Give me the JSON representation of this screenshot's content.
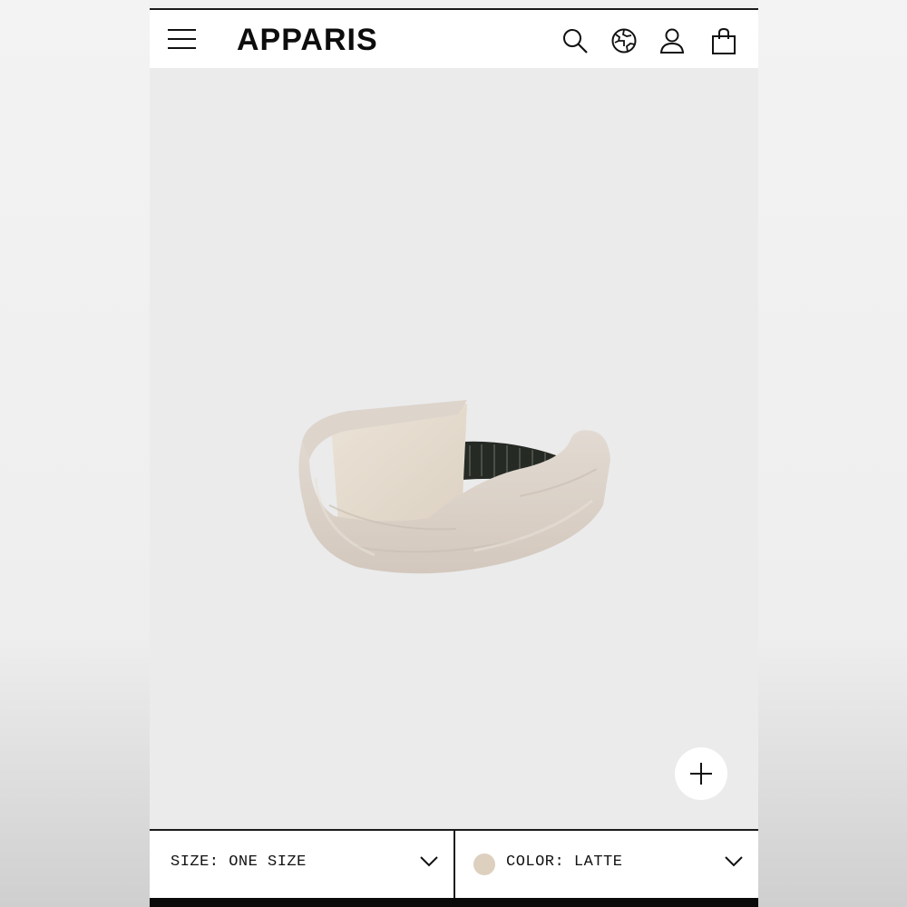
{
  "header": {
    "logo": "APPARIS",
    "icons": [
      "menu-icon",
      "search-icon",
      "globe-icon",
      "account-icon",
      "shopping-bag-icon"
    ]
  },
  "product": {
    "image_icon": "faux-fur-headband"
  },
  "zoom": {
    "icon": "plus-icon"
  },
  "selectors": {
    "size_label": "SIZE: ONE SIZE",
    "color_label": "COLOR: LATTE",
    "color_swatch": "#ddd0bf",
    "chevron_icon": "chevron-down-icon"
  },
  "colors": {
    "text": "#111111",
    "background": "#ebebec",
    "fur": "#dcd3ca"
  }
}
